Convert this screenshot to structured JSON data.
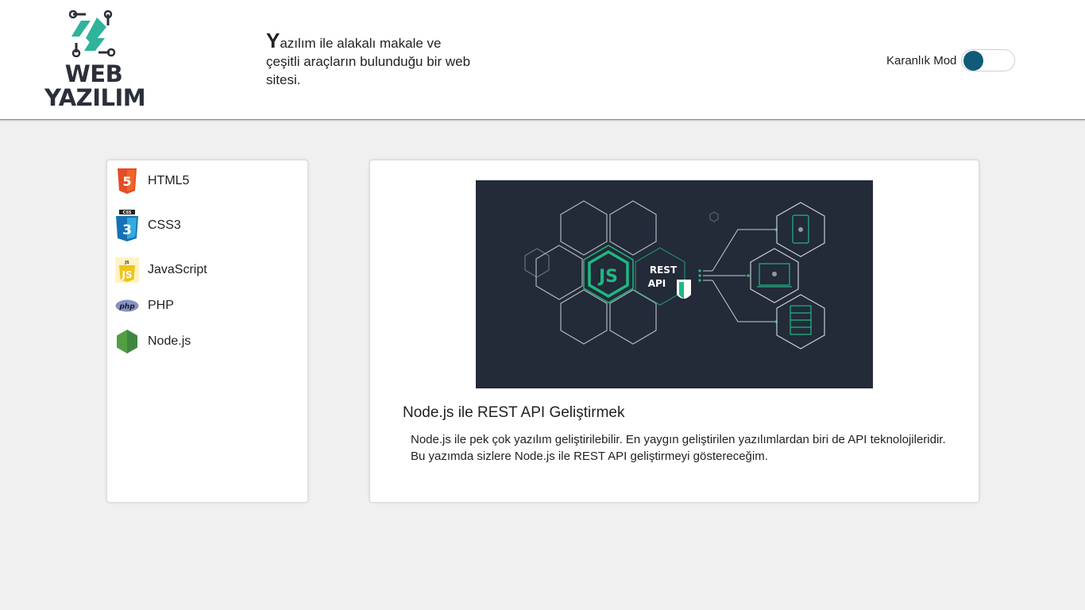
{
  "header": {
    "logo": {
      "line1": "WEB",
      "line2": "YAZILIM"
    },
    "tagline": {
      "first_letter": "Y",
      "rest": "azılım ile alakalı makale ve çeşitli araçların bulunduğu bir web sitesi."
    },
    "theme_toggle": {
      "label": "Karanlık Mod",
      "enabled": false
    }
  },
  "sidebar": {
    "items": [
      {
        "label": "HTML5",
        "icon": "html5-icon"
      },
      {
        "label": "CSS3",
        "icon": "css3-icon"
      },
      {
        "label": "JavaScript",
        "icon": "javascript-icon"
      },
      {
        "label": "PHP",
        "icon": "php-icon"
      },
      {
        "label": "Node.js",
        "icon": "nodejs-icon"
      }
    ]
  },
  "article": {
    "title": "Node.js ile REST API Geliştirmek",
    "description": "Node.js ile pek çok yazılım geliştirilebilir. En yaygın geliştirilen yazılımlardan biri de API teknolojileridir. Bu yazımda sizlere Node.js ile REST API geliştirmeyi göstereceğim.",
    "image": {
      "badge_text": "JS",
      "label_line1": "REST",
      "label_line2": "API"
    }
  },
  "colors": {
    "accent": "#0f5b78",
    "node_green": "#1fb883",
    "hero_bg": "#232a38",
    "page_bg": "#f0f0f0"
  }
}
